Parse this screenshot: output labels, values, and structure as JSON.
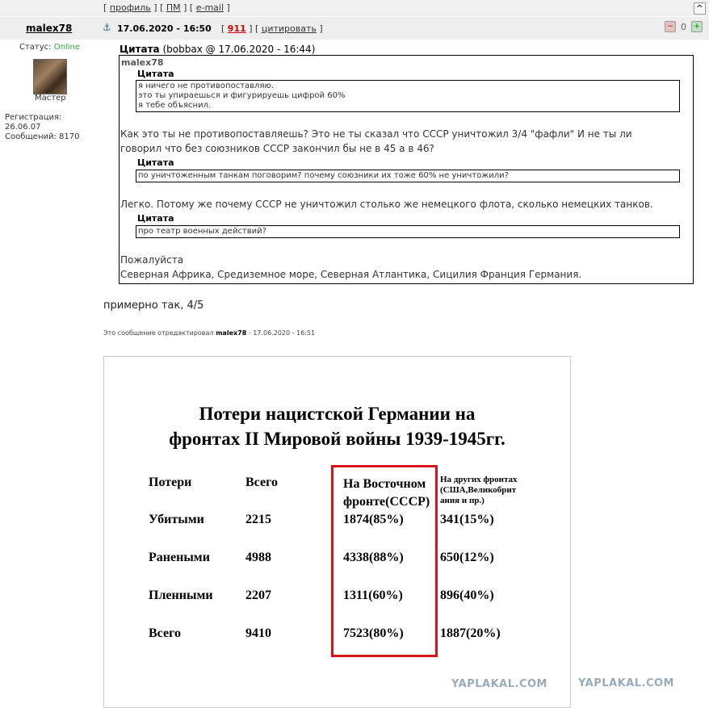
{
  "topbar": {
    "profile": "профиль",
    "pm": "ПМ",
    "email": "e-mail",
    "up": "^"
  },
  "post": {
    "author": "malex78",
    "date": "17.06.2020 - 16:50",
    "number": "911",
    "quote_action": "цитировать",
    "rating": "0"
  },
  "user": {
    "status_label": "Статус:",
    "status_value": "Online",
    "rank": "Мастер",
    "reg_label": "Регистрация:",
    "reg_date": "26.06.07",
    "msgs": "Сообщений: 8170"
  },
  "quote": {
    "label": "Цитата",
    "source": "(bobbax @ 17.06.2020 - 16:44)",
    "inner_author": "malex78",
    "q1_label": "Цитата",
    "q1_line1": "я ничего не противопоставляю.",
    "q1_line2": "это ты упираешься и фигурируешь цифрой 60%",
    "q1_line3": "я тебе объяснил.",
    "text1_line1": "Как это ты не противопоставляешь? Это не ты сказал что СССР уничтожил 3/4 \"фафли\" И не ты ли",
    "text1_line2": "говорил что без союзников СССР закончил бы не в 45 а в 46?",
    "q2_label": "Цитата",
    "q2_text": "по уничтоженным танкам поговорим? почему союзники их тоже 60% не уничтожили?",
    "text2": "Легко. Потому же почему СССР не уничтожил столько же немецкого флота, сколько немецких танков.",
    "q3_label": "Цитата",
    "q3_text": "про театр военных действий?",
    "text3_line1": "Пожалуйста",
    "text3_line2": "Северная Африка, Средиземное море, Северная Атлантика, Сицилия Франция Германия."
  },
  "reply": "примерно так, 4/5",
  "edited": {
    "prefix": "Это сообщение отредактировал",
    "author": "malex78",
    "suffix": "- 17.06.2020 - 16:51"
  },
  "image": {
    "title_line1": "Потери нацистской Германии на",
    "title_line2": "фронтах II Мировой войны 1939-1945гг.",
    "headers": [
      "Потери",
      "Всего",
      "На Восточном фронте(СССР)",
      "На других фронтах (США,Великобрит ания и пр.)"
    ],
    "header3_line1": "На Восточном",
    "header3_line2": "фронте(СССР)",
    "header4_line1": "На других фронтах",
    "header4_line2": "(США,Великобрит",
    "header4_line3": "ания и пр.)",
    "rows": [
      {
        "label": "Убитыми",
        "total": "2215",
        "east": "1874(85%)",
        "other": "341(15%)"
      },
      {
        "label": "Ранеными",
        "total": "4988",
        "east": "4338(88%)",
        "other": "650(12%)"
      },
      {
        "label": "Пленными",
        "total": "2207",
        "east": "1311(60%)",
        "other": "896(40%)"
      },
      {
        "label": "Всего",
        "total": "9410",
        "east": "7523(80%)",
        "other": "1887(20%)"
      }
    ],
    "watermark": "YAPLAKAL.COM",
    "highlight_color": "#d8141c"
  }
}
